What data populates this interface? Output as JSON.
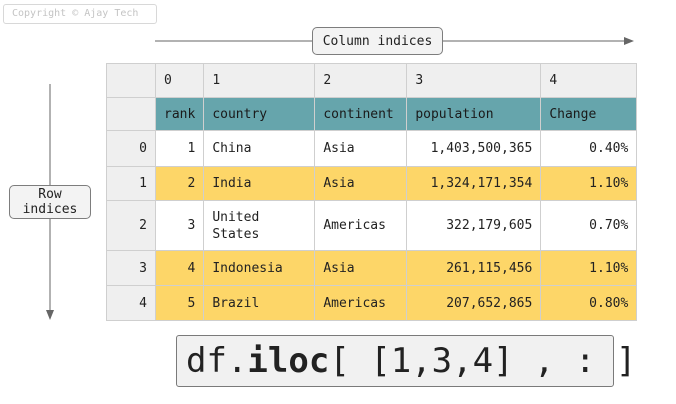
{
  "copyright": "Copyright © Ajay Tech",
  "column_label": "Column indices",
  "row_label": "Row\nindices",
  "column_positions": [
    "0",
    "1",
    "2",
    "3",
    "4"
  ],
  "column_names": [
    "rank",
    "country",
    "continent",
    "population",
    "Change"
  ],
  "rows": [
    {
      "index": "0",
      "rank": "1",
      "country": "China",
      "continent": "Asia",
      "population": "1,403,500,365",
      "change": "0.40%",
      "selected": false
    },
    {
      "index": "1",
      "rank": "2",
      "country": "India",
      "continent": "Asia",
      "population": "1,324,171,354",
      "change": "1.10%",
      "selected": true
    },
    {
      "index": "2",
      "rank": "3",
      "country": "United States",
      "continent": "Americas",
      "population": "322,179,605",
      "change": "0.70%",
      "selected": false
    },
    {
      "index": "3",
      "rank": "4",
      "country": "Indonesia",
      "continent": "Asia",
      "population": "261,115,456",
      "change": "1.10%",
      "selected": true
    },
    {
      "index": "4",
      "rank": "5",
      "country": "Brazil",
      "continent": "Americas",
      "population": "207,652,865",
      "change": "0.80%",
      "selected": true
    }
  ],
  "code": {
    "prefix": "df.",
    "method": "iloc",
    "args": "[ [1,3,4] , : ]"
  },
  "colors": {
    "header_teal": "#66a5ac",
    "selected_row": "#fdd668",
    "index_grey": "#efefef"
  }
}
